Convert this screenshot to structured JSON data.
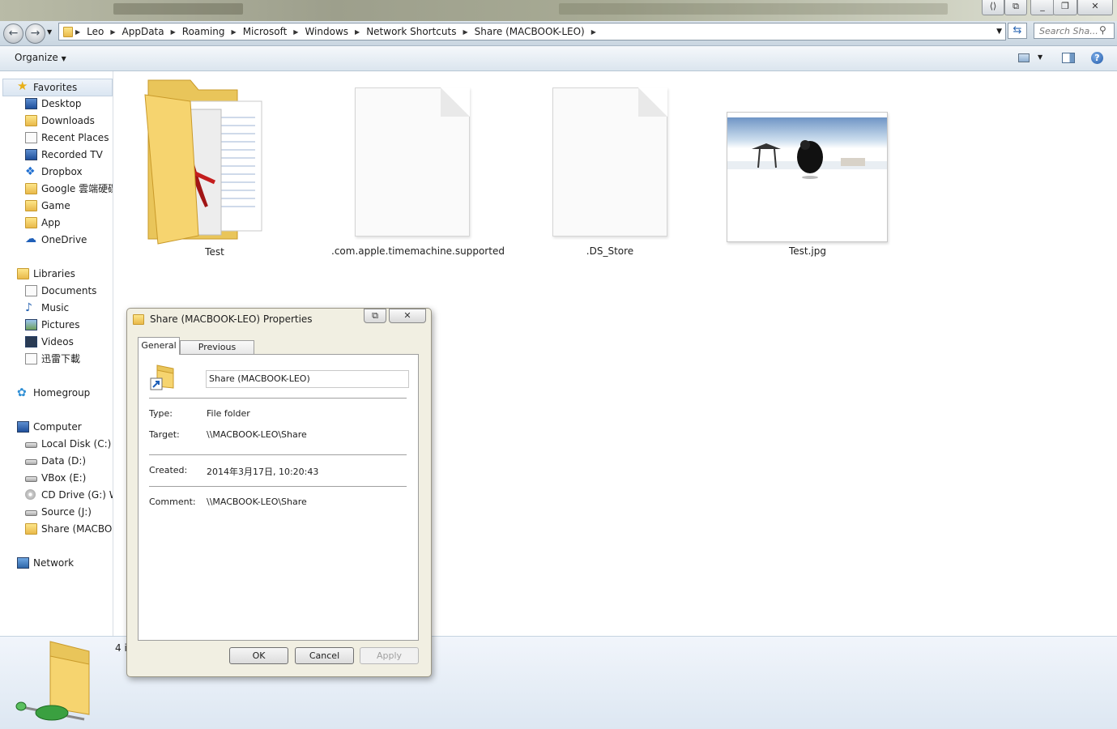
{
  "window": {
    "colors": {
      "accent": "#2a66b3",
      "address_bg": "#dfe7ee"
    }
  },
  "breadcrumb": [
    "Leo",
    "AppData",
    "Roaming",
    "Microsoft",
    "Windows",
    "Network Shortcuts",
    "Share (MACBOOK-LEO)"
  ],
  "search": {
    "placeholder": "Search Sha..."
  },
  "toolbar": {
    "organize_label": "Organize"
  },
  "sidebar": {
    "favorites": {
      "label": "Favorites",
      "items": [
        "Desktop",
        "Downloads",
        "Recent Places",
        "Recorded TV",
        "Dropbox",
        "Google 雲端硬碟",
        "Game",
        "App",
        "OneDrive"
      ]
    },
    "libraries": {
      "label": "Libraries",
      "items": [
        "Documents",
        "Music",
        "Pictures",
        "Videos",
        "迅雷下載"
      ]
    },
    "homegroup": {
      "label": "Homegroup"
    },
    "computer": {
      "label": "Computer",
      "items": [
        "Local Disk (C:)",
        "Data (D:)",
        "VBox (E:)",
        "CD Drive (G:) WD",
        "Source (J:)",
        "Share (MACBOOK"
      ]
    },
    "network": {
      "label": "Network"
    }
  },
  "files": [
    {
      "name": "Test",
      "icon": "folder-with-documents-icon"
    },
    {
      "name": ".com.apple.timemachine.supported",
      "icon": "blank-file-icon"
    },
    {
      "name": ".DS_Store",
      "icon": "blank-file-icon"
    },
    {
      "name": "Test.jpg",
      "icon": "image-thumbnail-icon"
    }
  ],
  "details": {
    "count_text": "4 i"
  },
  "dialog": {
    "title": "Share (MACBOOK-LEO) Properties",
    "tabs": [
      "General",
      "Previous Versions"
    ],
    "name_value": "Share (MACBOOK-LEO)",
    "type_label": "Type:",
    "type_value": "File folder",
    "target_label": "Target:",
    "target_value": "\\\\MACBOOK-LEO\\Share",
    "created_label": "Created:",
    "created_value": "2014年3月17日, 10:20:43",
    "comment_label": "Comment:",
    "comment_value": "\\\\MACBOOK-LEO\\Share",
    "ok_label": "OK",
    "cancel_label": "Cancel",
    "apply_label": "Apply"
  }
}
